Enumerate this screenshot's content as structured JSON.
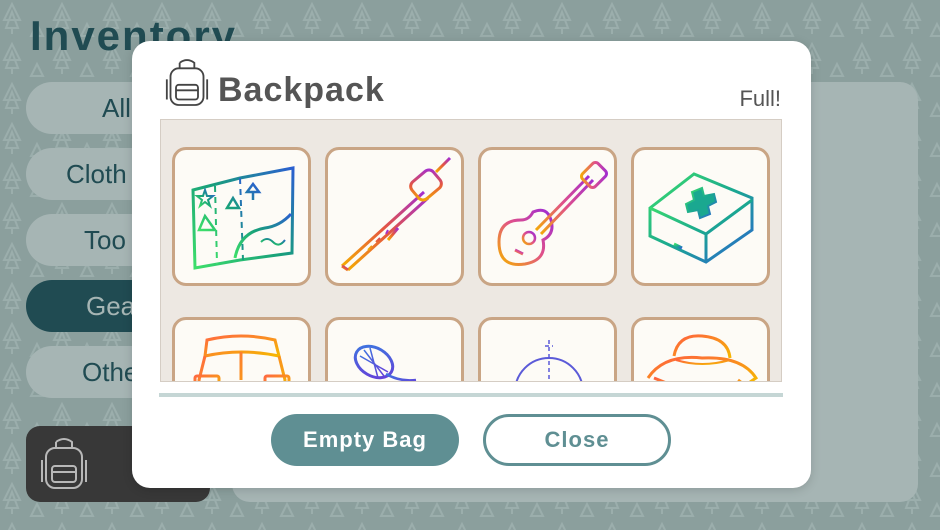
{
  "background": {
    "title": "Inventory",
    "nav": [
      {
        "label": "All",
        "icon": "all-category"
      },
      {
        "label": "Cloth",
        "icon": "clothing-category"
      },
      {
        "label": "Too",
        "icon": "tools-category"
      },
      {
        "label": "Gea",
        "icon": "gear-category",
        "active": true
      },
      {
        "label": "Othe",
        "icon": "other-category"
      }
    ],
    "bag_icon": "backpack-icon"
  },
  "modal": {
    "title": "Backpack",
    "status": "Full!",
    "icon": "backpack-icon",
    "items": [
      {
        "name": "map",
        "icon": "map-icon"
      },
      {
        "name": "marshmallow-stick",
        "icon": "marshmallow-stick-icon"
      },
      {
        "name": "guitar",
        "icon": "guitar-icon"
      },
      {
        "name": "first-aid-kit",
        "icon": "first-aid-kit-icon"
      },
      {
        "name": "shorts",
        "icon": "shorts-icon"
      },
      {
        "name": "butterfly-net",
        "icon": "butterfly-net-icon"
      },
      {
        "name": "compass",
        "icon": "compass-icon"
      },
      {
        "name": "safari-hat",
        "icon": "hat-icon"
      }
    ],
    "buttons": {
      "empty": "Empty Bag",
      "close": "Close"
    }
  },
  "colors": {
    "primary": "#5f8f93",
    "dark_teal": "#23525a",
    "slot_border": "#c9a585",
    "slot_bg": "#fdfbf6",
    "grid_bg": "#ede8e2"
  }
}
